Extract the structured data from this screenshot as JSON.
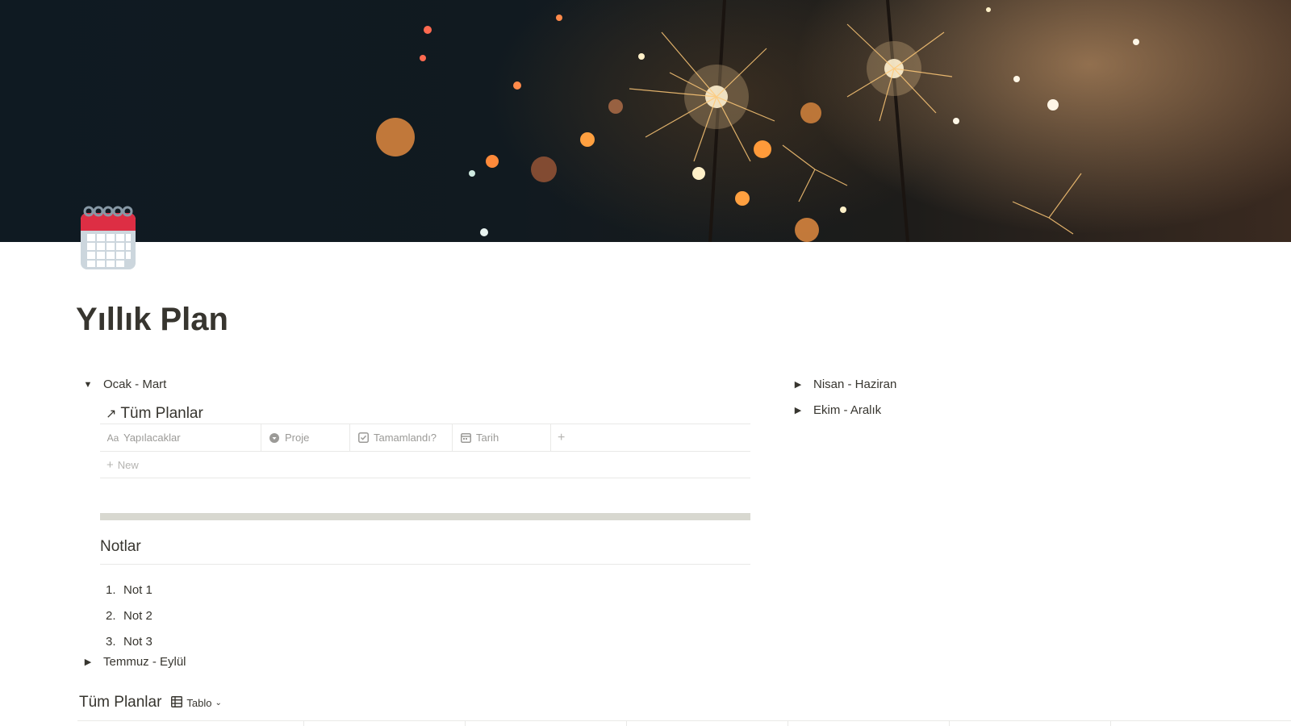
{
  "page": {
    "title": "Yıllık Plan",
    "icon": "calendar-icon"
  },
  "toggles_left": {
    "q1": {
      "label": "Ocak - Mart",
      "expanded": true
    },
    "q3": {
      "label": "Temmuz - Eylül",
      "expanded": false
    }
  },
  "toggles_right": {
    "q2": {
      "label": "Nisan - Haziran",
      "expanded": false
    },
    "q4": {
      "label": "Ekim - Aralık",
      "expanded": false
    }
  },
  "linked_db": {
    "title": "Tüm Planlar",
    "columns": [
      {
        "label": "Yapılacaklar",
        "icon": "text-property-icon"
      },
      {
        "label": "Proje",
        "icon": "relation-property-icon"
      },
      {
        "label": "Tamamlandı?",
        "icon": "checkbox-property-icon"
      },
      {
        "label": "Tarih",
        "icon": "date-property-icon"
      }
    ],
    "add_column": "+",
    "new_row_label": "New"
  },
  "notes": {
    "heading": "Notlar",
    "items": [
      {
        "num": "1.",
        "text": "Not 1"
      },
      {
        "num": "2.",
        "text": "Not 2"
      },
      {
        "num": "3.",
        "text": "Not 3"
      }
    ]
  },
  "bottom_db": {
    "title": "Tüm Planlar",
    "view_label": "Tablo",
    "view_icon": "table-icon"
  },
  "colors": {
    "text": "#37352f",
    "muted": "#9b9a97",
    "border": "#e9e9e7",
    "divider": "#d8d8d0",
    "calendar_red": "#dd2e44"
  }
}
